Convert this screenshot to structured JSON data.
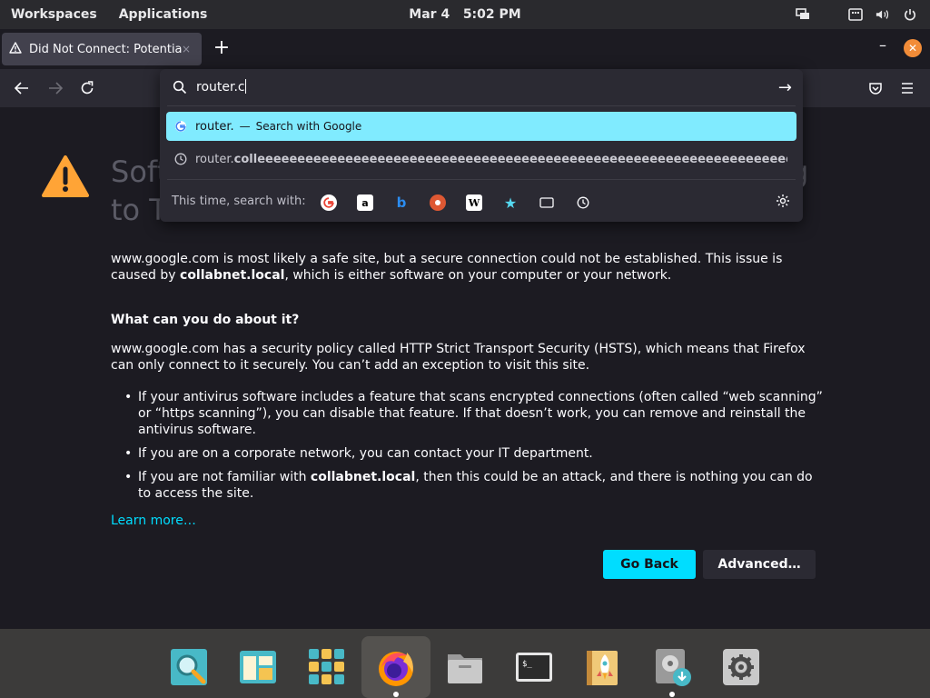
{
  "topbar": {
    "workspaces": "Workspaces",
    "applications": "Applications",
    "date": "Mar 4",
    "time": "5:02 PM"
  },
  "tab": {
    "title": "Did Not Connect: Potential",
    "close": "×"
  },
  "toolbar": {
    "new_tab": "+",
    "minimize": "–",
    "close": "✕"
  },
  "urlbar": {
    "typed_text": "router.c",
    "go": "→",
    "suggestions": [
      {
        "main": "router.",
        "separator": "—",
        "action": "Search with Google",
        "icon": "google-icon"
      },
      {
        "prefix": "router.",
        "bold": "colleeeeeeeeeeeeeeeeeeeeeeeeeeeeeeeeeeeeeeeeeeeeeeeeeeeeeeeeeeeeeeeeeeeeeeeeeeeeee",
        "icon": "history-clock-icon"
      }
    ],
    "one_off_label": "This time, search with:",
    "engines": [
      "google",
      "amazon",
      "bing",
      "duckduckgo",
      "wikipedia",
      "bookmarks",
      "tabs",
      "history"
    ]
  },
  "page": {
    "title_line1": "Soft",
    "title_line1_tail": "g",
    "title_line2": "to T",
    "para1_a": "www.google.com is most likely a safe site, but a secure connection could not be established. This issue is caused by ",
    "para1_bold": "collabnet.local",
    "para1_b": ", which is either software on your computer or your network.",
    "heading": "What can you do about it?",
    "para2": "www.google.com has a security policy called HTTP Strict Transport Security (HSTS), which means that Firefox can only connect to it securely. You can’t add an exception to visit this site.",
    "bullet1": "If your antivirus software includes a feature that scans encrypted connections (often called “web scanning” or “https scanning”), you can disable that feature. If that doesn’t work, you can remove and reinstall the antivirus software.",
    "bullet2": "If you are on a corporate network, you can contact your IT department.",
    "bullet3_a": "If you are not familiar with ",
    "bullet3_bold": "collabnet.local",
    "bullet3_b": ", then this could be an attack, and there is nothing you can do to access the site.",
    "learn_more": "Learn more…",
    "go_back": "Go Back",
    "advanced": "Advanced…"
  },
  "dock": {
    "items": [
      "search-app",
      "files-layout",
      "applications-grid",
      "firefox",
      "files",
      "terminal",
      "launcher-rocket",
      "installer",
      "settings"
    ],
    "terminal_glyph": "$_"
  },
  "colors": {
    "accent": "#00ddff",
    "selected_suggestion": "#80ebff",
    "warning": "#ffa436",
    "close_button": "#f28c38"
  }
}
